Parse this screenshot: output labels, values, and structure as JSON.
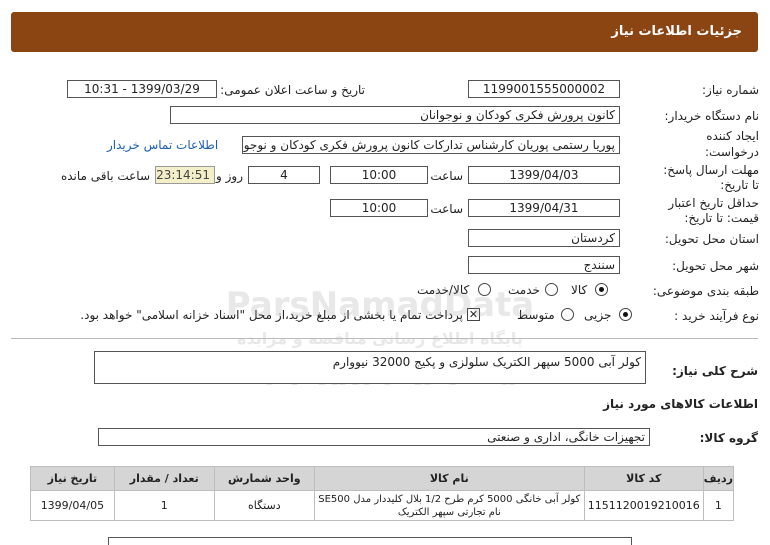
{
  "header": {
    "title": "جزئیات اطلاعات نیاز"
  },
  "form": {
    "need_number_label": "شماره نیاز:",
    "need_number": "1199001555000002",
    "announce_label": "تاریخ و ساعت اعلان عمومی:",
    "announce_value": "1399/03/29 - 10:31",
    "buyer_label": "نام دستگاه خریدار:",
    "buyer_value": "کانون پرورش فکری کودکان و نوجوانان",
    "creator_label_1": "ایجاد کننده",
    "creator_label_2": "درخواست:",
    "creator_value": "پوریا رستمی پوریان کارشناس تدارکات کانون پرورش فکری کودکان و نوجوانان",
    "contact_link": "اطلاعات تماس خریدار",
    "reply_label_1": "مهلت ارسال پاسخ:",
    "reply_label_2": "تا تاریخ:",
    "reply_date": "1399/04/03",
    "time_label": "ساعت",
    "reply_time": "10:00",
    "day_label": "روز و",
    "days_value": "4",
    "remaining_time": "23:14:51",
    "remaining_label": "ساعت باقی مانده",
    "price_label_1": "حداقل تاریخ اعتبار",
    "price_label_2": "قیمت: تا تاریخ:",
    "price_date": "1399/04/31",
    "price_time": "10:00",
    "province_label": "استان محل تحویل:",
    "province_value": "کردستان",
    "city_label": "شهر محل تحویل:",
    "city_value": "سنندج",
    "category_label": "طبقه بندی موضوعی:",
    "category_options": [
      "کالا",
      "خدمت",
      "کالا/خدمت"
    ],
    "category_selected": "کالا",
    "process_label": "نوع فرآیند خرید :",
    "process_options": [
      "جزیی",
      "متوسط"
    ],
    "process_selected": "جزیی",
    "payment_note": "پرداخت تمام یا بخشی از مبلغ خرید،از محل \"اسناد خزانه اسلامی\" خواهد بود."
  },
  "watermark": {
    "line1": "ParsNamadData",
    "line2": "پایگاه اطلاع رسانی مناقصه و مزایده",
    "line3": "۰۲۱-۸۸۳۴۹۶۷۰-۵"
  },
  "description": {
    "label": "شرح کلی نیاز:",
    "value": "کولر آبی 5000 سپهر الکتریک سلولزی و پکیج 32000 نیووارم"
  },
  "goods_section": {
    "title": "اطلاعات کالاهای مورد نیاز",
    "group_label": "گروه کالا:",
    "group_value": "تجهیزات خانگی، اداری و صنعتی"
  },
  "table": {
    "headers": [
      "ردیف",
      "کد کالا",
      "نام کالا",
      "واحد شمارش",
      "تعداد / مقدار",
      "تاریخ نیاز"
    ],
    "rows": [
      {
        "row": "1",
        "code": "1151120019210016",
        "name_line1": "کولر آبی خانگی 5000 کرم طرح 1/2 بلال کلیددار مدل SE500",
        "name_line2": "نام تجارتی سپهر الکتریک",
        "unit": "دستگاه",
        "qty": "1",
        "date": "1399/04/05"
      }
    ]
  }
}
